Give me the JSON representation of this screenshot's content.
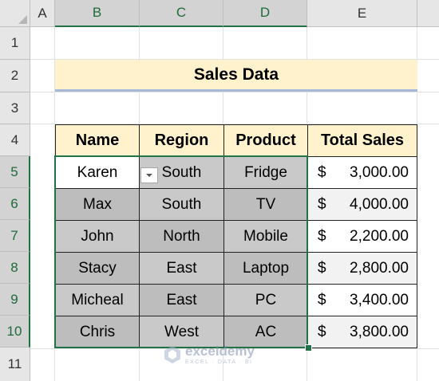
{
  "columns": [
    "A",
    "B",
    "C",
    "D",
    "E"
  ],
  "rows": [
    "1",
    "2",
    "3",
    "4",
    "5",
    "6",
    "7",
    "8",
    "9",
    "10",
    "11"
  ],
  "title": "Sales Data",
  "table": {
    "headers": [
      "Name",
      "Region",
      "Product",
      "Total Sales"
    ],
    "currency_symbol": "$",
    "rows": [
      {
        "name": "Karen",
        "region": "South",
        "product": "Fridge",
        "sales": "3,000.00"
      },
      {
        "name": "Max",
        "region": "South",
        "product": "TV",
        "sales": "4,000.00"
      },
      {
        "name": "John",
        "region": "North",
        "product": "Mobile",
        "sales": "2,200.00"
      },
      {
        "name": "Stacy",
        "region": "East",
        "product": "Laptop",
        "sales": "2,800.00"
      },
      {
        "name": "Micheal",
        "region": "East",
        "product": "PC",
        "sales": "3,400.00"
      },
      {
        "name": "Chris",
        "region": "West",
        "product": "AC",
        "sales": "3,800.00"
      }
    ]
  },
  "watermark": {
    "name": "exceldemy",
    "tagline": "EXCEL · DATA · BI"
  },
  "colors": {
    "accent": "#217346",
    "header_fill": "#fff2cc",
    "gray_fill": "#bdbdbd"
  },
  "icons": {
    "dropdown": "chevron-down-icon",
    "logo": "exceldemy-logo-icon"
  }
}
